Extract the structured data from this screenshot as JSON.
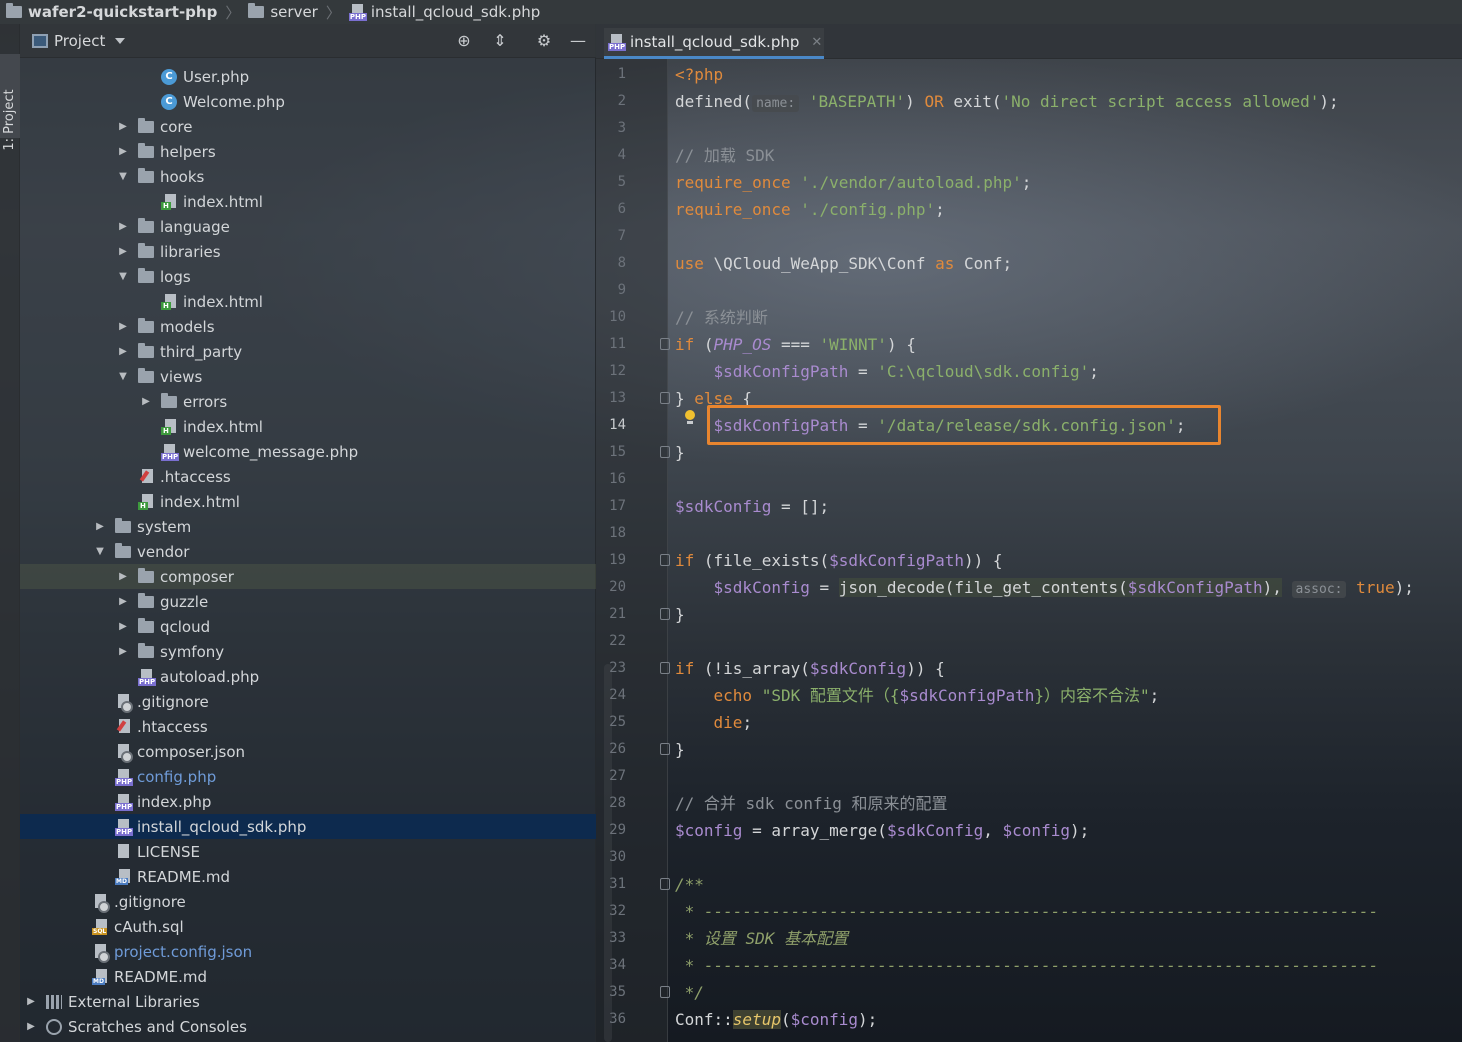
{
  "breadcrumb": {
    "project": "wafer2-quickstart-php",
    "folder": "server",
    "file": "install_qcloud_sdk.php"
  },
  "tool_strip": {
    "label": "1: Project"
  },
  "project_panel": {
    "title": "Project",
    "icons": [
      "locate-icon",
      "collapse-icon",
      "settings-icon",
      "hide-icon"
    ]
  },
  "tree": [
    {
      "label": "User.php",
      "type": "class",
      "depth": 6
    },
    {
      "label": "Welcome.php",
      "type": "class",
      "depth": 6
    },
    {
      "label": "core",
      "type": "folder",
      "depth": 5,
      "expanded": false
    },
    {
      "label": "helpers",
      "type": "folder",
      "depth": 5,
      "expanded": false
    },
    {
      "label": "hooks",
      "type": "folder",
      "depth": 5,
      "expanded": true
    },
    {
      "label": "index.html",
      "type": "html",
      "depth": 6
    },
    {
      "label": "language",
      "type": "folder",
      "depth": 5,
      "expanded": false
    },
    {
      "label": "libraries",
      "type": "folder",
      "depth": 5,
      "expanded": false
    },
    {
      "label": "logs",
      "type": "folder",
      "depth": 5,
      "expanded": true
    },
    {
      "label": "index.html",
      "type": "html",
      "depth": 6
    },
    {
      "label": "models",
      "type": "folder",
      "depth": 5,
      "expanded": false
    },
    {
      "label": "third_party",
      "type": "folder",
      "depth": 5,
      "expanded": false
    },
    {
      "label": "views",
      "type": "folder",
      "depth": 5,
      "expanded": true
    },
    {
      "label": "errors",
      "type": "folder",
      "depth": 6,
      "expanded": false
    },
    {
      "label": "index.html",
      "type": "html",
      "depth": 6
    },
    {
      "label": "welcome_message.php",
      "type": "php",
      "depth": 6
    },
    {
      "label": ".htaccess",
      "type": "htaccess",
      "depth": 5
    },
    {
      "label": "index.html",
      "type": "html",
      "depth": 5
    },
    {
      "label": "system",
      "type": "folder",
      "depth": 4,
      "expanded": false
    },
    {
      "label": "vendor",
      "type": "folder",
      "depth": 4,
      "expanded": true
    },
    {
      "label": "composer",
      "type": "folder",
      "depth": 5,
      "expanded": false,
      "hover": true
    },
    {
      "label": "guzzle",
      "type": "folder",
      "depth": 5,
      "expanded": false
    },
    {
      "label": "qcloud",
      "type": "folder",
      "depth": 5,
      "expanded": false
    },
    {
      "label": "symfony",
      "type": "folder",
      "depth": 5,
      "expanded": false
    },
    {
      "label": "autoload.php",
      "type": "php",
      "depth": 5
    },
    {
      "label": ".gitignore",
      "type": "git",
      "depth": 4
    },
    {
      "label": ".htaccess",
      "type": "htaccess",
      "depth": 4
    },
    {
      "label": "composer.json",
      "type": "json",
      "depth": 4
    },
    {
      "label": "config.php",
      "type": "php",
      "depth": 4,
      "blue": true
    },
    {
      "label": "index.php",
      "type": "php",
      "depth": 4
    },
    {
      "label": "install_qcloud_sdk.php",
      "type": "php",
      "depth": 4,
      "selected": true
    },
    {
      "label": "LICENSE",
      "type": "txt",
      "depth": 4
    },
    {
      "label": "README.md",
      "type": "md",
      "depth": 4
    },
    {
      "label": ".gitignore",
      "type": "git",
      "depth": 3
    },
    {
      "label": "cAuth.sql",
      "type": "sql",
      "depth": 3
    },
    {
      "label": "project.config.json",
      "type": "json",
      "depth": 3,
      "blue": true
    },
    {
      "label": "README.md",
      "type": "md",
      "depth": 3
    },
    {
      "label": "External Libraries",
      "type": "lib",
      "depth": 1,
      "expanded": false
    },
    {
      "label": "Scratches and Consoles",
      "type": "scratch",
      "depth": 1,
      "expanded": false
    }
  ],
  "editor": {
    "tab_label": "install_qcloud_sdk.php",
    "current_line": 14,
    "hints": {
      "name": "name:",
      "assoc": "assoc:"
    },
    "lines": [
      "<?php",
      "defined(name: 'BASEPATH') OR exit('No direct script access allowed');",
      "",
      "// 加载 SDK",
      "require_once './vendor/autoload.php';",
      "require_once './config.php';",
      "",
      "use \\QCloud_WeApp_SDK\\Conf as Conf;",
      "",
      "// 系统判断",
      "if (PHP_OS === 'WINNT') {",
      "    $sdkConfigPath = 'C:\\qcloud\\sdk.config';",
      "} else {",
      "    $sdkConfigPath = '/data/release/sdk.config.json';",
      "}",
      "",
      "$sdkConfig = [];",
      "",
      "if (file_exists($sdkConfigPath)) {",
      "    $sdkConfig = json_decode(file_get_contents($sdkConfigPath), assoc: true);",
      "}",
      "",
      "if (!is_array($sdkConfig)) {",
      "    echo \"SDK 配置文件（{$sdkConfigPath}）内容不合法\";",
      "    die;",
      "}",
      "",
      "// 合并 sdk config 和原来的配置",
      "$config = array_merge($sdkConfig, $config);",
      "",
      "/**",
      " * ----------------------------------------------------------------------",
      " * 设置 SDK 基本配置",
      " * ----------------------------------------------------------------------",
      " */",
      "Conf::setup($config);"
    ]
  }
}
